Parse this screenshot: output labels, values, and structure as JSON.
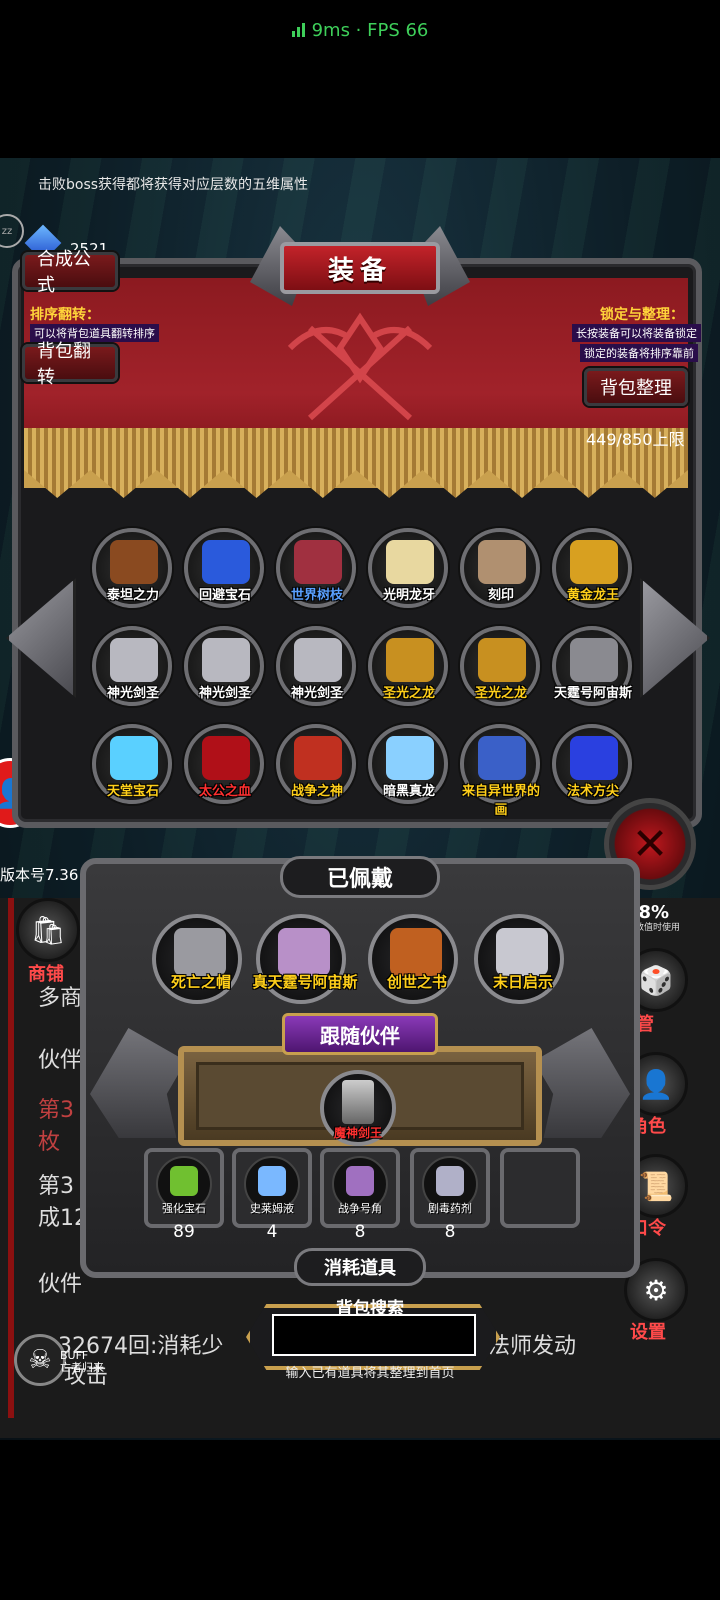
{
  "status_bar": {
    "text": "9ms · FPS 66",
    "color": "#3ecf5a"
  },
  "notice": "击败boss获得都将获得对应层数的五维属性",
  "currency": {
    "gems": "2521"
  },
  "zz_badge": "zz",
  "panel": {
    "title": "装备",
    "buttons": {
      "formula": "合成公式",
      "flip": "背包翻转",
      "organize": "背包整理"
    },
    "sort_flip": {
      "label": "排序翻转：",
      "note": "可以将背包道具翻转排序"
    },
    "lock_org": {
      "label": "锁定与整理：",
      "note1": "长按装备可以将装备锁定",
      "note2": "锁定的装备将排序靠前"
    },
    "capacity": "449/850上限"
  },
  "inventory": [
    {
      "name": "泰坦之力",
      "color": "#ffffff",
      "art": "#8a4a20"
    },
    {
      "name": "回避宝石",
      "color": "#ffffff",
      "art": "#2a5adc"
    },
    {
      "name": "世界树枝",
      "color": "#5aa0ff",
      "art": "#a03040"
    },
    {
      "name": "光明龙牙",
      "color": "#ffffff",
      "art": "#e8d8a0"
    },
    {
      "name": "刻印",
      "color": "#ffffff",
      "art": "#b09070"
    },
    {
      "name": "黄金龙王",
      "color": "#ffcf1a",
      "art": "#d8a020"
    },
    {
      "name": "神光剑圣",
      "color": "#ffffff",
      "art": "#b8b8c0"
    },
    {
      "name": "神光剑圣",
      "color": "#ffffff",
      "art": "#b8b8c0"
    },
    {
      "name": "神光剑圣",
      "color": "#ffffff",
      "art": "#b8b8c0"
    },
    {
      "name": "圣光之龙",
      "color": "#ffcf1a",
      "art": "#c89020"
    },
    {
      "name": "圣光之龙",
      "color": "#ffcf1a",
      "art": "#c89020"
    },
    {
      "name": "天霆号阿宙斯",
      "color": "#ffffff",
      "art": "#8a8a90"
    },
    {
      "name": "天堂宝石",
      "color": "#ffcf1a",
      "art": "#5ad0ff"
    },
    {
      "name": "太公之血",
      "color": "#ff3030",
      "art": "#b01018"
    },
    {
      "name": "战争之神",
      "color": "#ffcf1a",
      "art": "#c03020"
    },
    {
      "name": "暗黑真龙",
      "color": "#ffffff",
      "art": "#8ad0ff"
    },
    {
      "name": "来自异世界的画",
      "color": "#ffcf1a",
      "art": "#3a60c8"
    },
    {
      "name": "法术方尖",
      "color": "#ffcf1a",
      "art": "#2a40e0"
    }
  ],
  "worn": {
    "title": "已佩戴",
    "items": [
      {
        "name": "死亡之帽",
        "art": "#9a9aa0"
      },
      {
        "name": "真天霆号阿宙斯",
        "art": "#b890c8"
      },
      {
        "name": "创世之书",
        "art": "#c06020"
      },
      {
        "name": "末日启示",
        "art": "#c8c8d0"
      }
    ]
  },
  "companion": {
    "title": "跟随伙伴",
    "name": "魔神剑王"
  },
  "consumables": {
    "title": "消耗道具",
    "items": [
      {
        "name": "强化宝石",
        "count": "89",
        "art": "#70c030"
      },
      {
        "name": "史莱姆液",
        "count": "4",
        "art": "#7ab8ff"
      },
      {
        "name": "战争号角",
        "count": "8",
        "art": "#a070c0"
      },
      {
        "name": "剧毒药剂",
        "count": "8",
        "art": "#b0b0c8"
      }
    ]
  },
  "search": {
    "label": "背包搜索",
    "value": "",
    "hint": "输入已有道具将其整理到首页"
  },
  "background": {
    "version": "版本号7.36",
    "shop": "商铺",
    "lines": [
      "多商",
      "伙伴",
      "第3",
      "枚",
      "第3",
      "成12",
      "伙件"
    ],
    "log": "32674回:消耗少",
    "log2": "法师发动",
    "log3": "攻击",
    "right_number": "58%",
    "right_tiny": "其数值时使用",
    "side": [
      "管",
      "角色",
      "口令",
      "设置"
    ],
    "buff": [
      "BUFF",
      "亡者归来"
    ]
  },
  "colors": {
    "banner": "#a1222a",
    "gold": "#c9a04e",
    "frame": "#5a5a5e"
  }
}
